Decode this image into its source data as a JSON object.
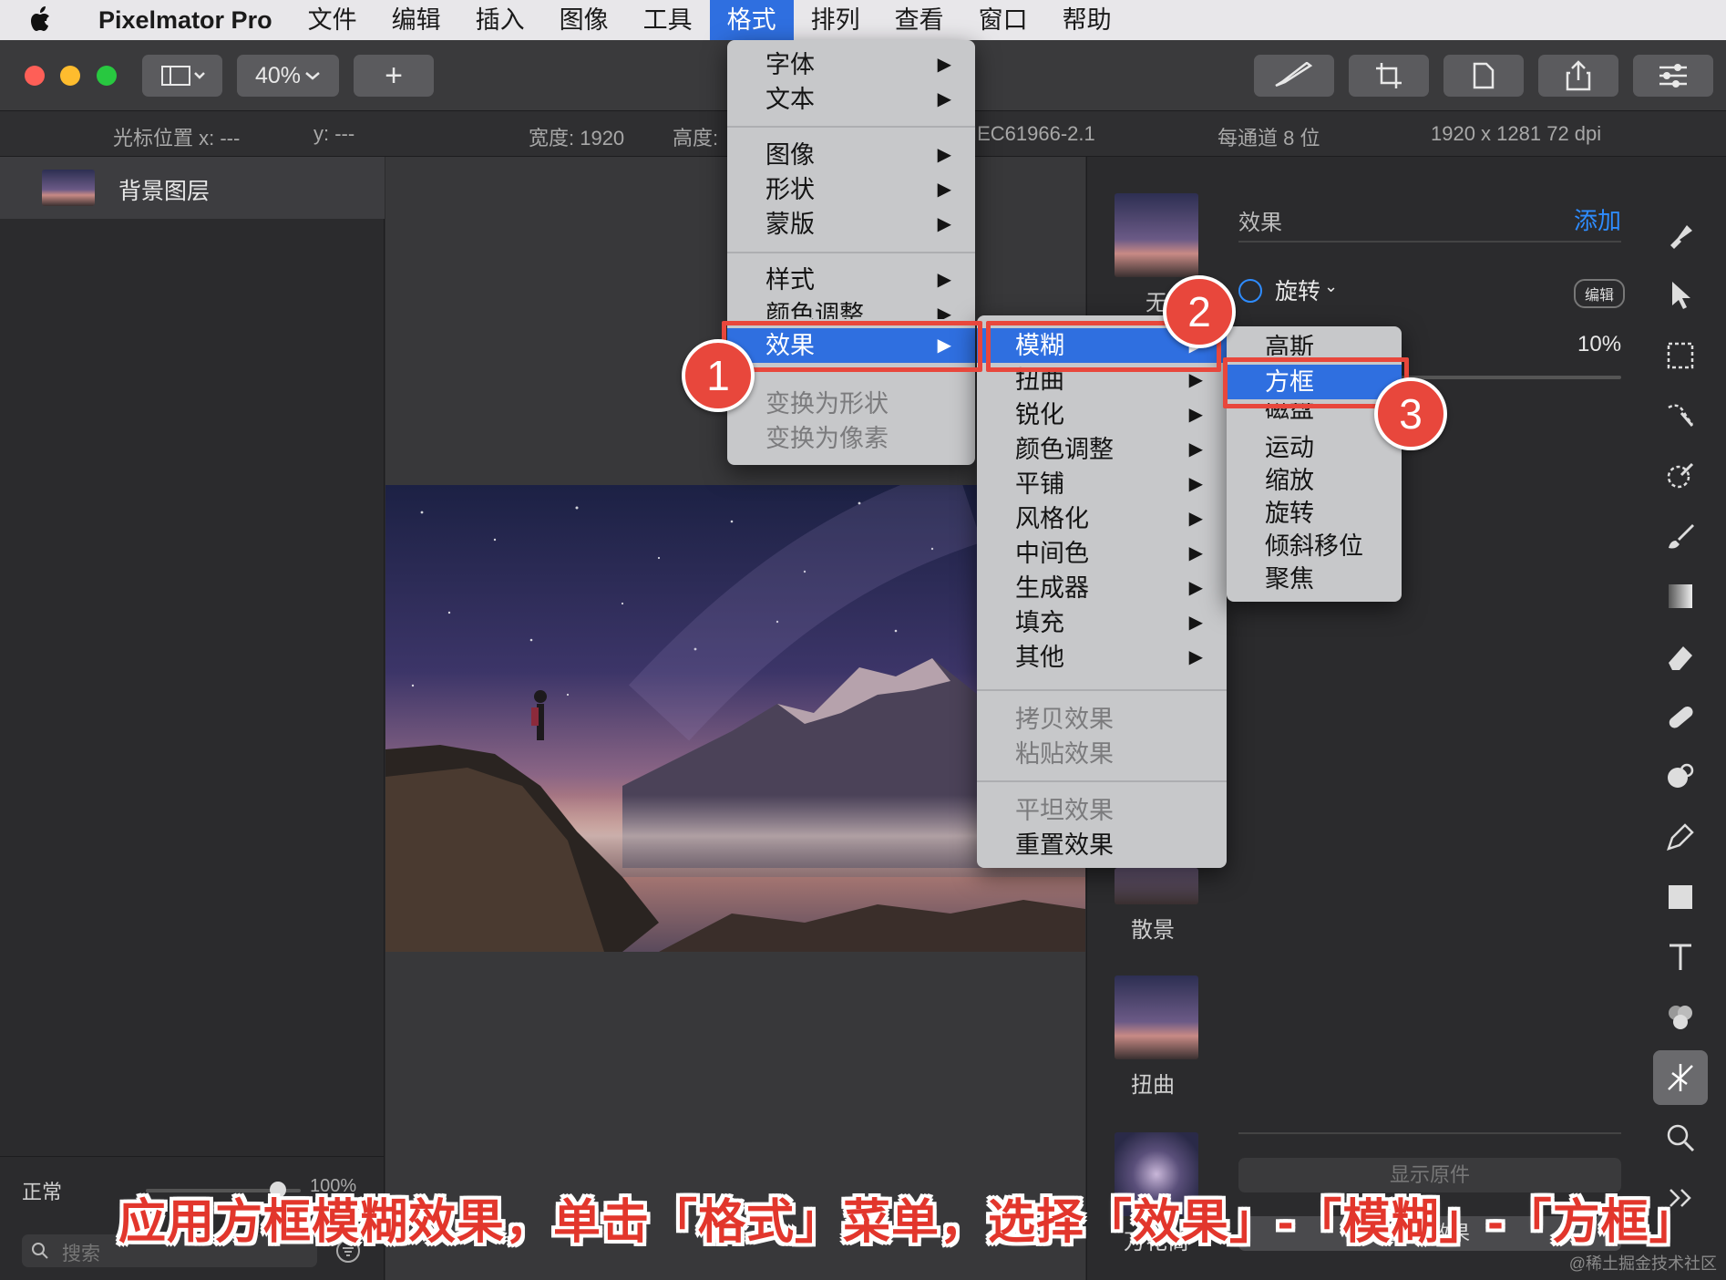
{
  "menubar": {
    "app_name": "Pixelmator Pro",
    "items": [
      "文件",
      "编辑",
      "插入",
      "图像",
      "工具",
      "格式",
      "排列",
      "查看",
      "窗口",
      "帮助"
    ],
    "active": "格式"
  },
  "toolbar": {
    "zoom": "40%",
    "add": "+"
  },
  "infobar": {
    "cursor_x": "光标位置 x:  ---",
    "cursor_y": "y:  ---",
    "width": "宽度:  1920",
    "height": "高度:",
    "profile": "IEC61966-2.1",
    "bits": "每通道 8 位",
    "size": "1920 x 1281 72 dpi"
  },
  "layers": {
    "items": [
      {
        "name": "背景图层"
      }
    ],
    "blend_mode": "正常",
    "opacity": "100%",
    "search_placeholder": "搜索"
  },
  "effects_panel": {
    "header": "效果",
    "add": "添加",
    "effect_name": "旋转",
    "edit": "编辑",
    "value": "10%",
    "presets": [
      "无",
      "散景",
      "扭曲",
      "万花筒"
    ],
    "show_original": "显示原件",
    "reset": "重置效果"
  },
  "format_menu": {
    "group1": [
      "字体",
      "文本"
    ],
    "group2": [
      "图像",
      "形状",
      "蒙版"
    ],
    "group3": [
      "样式",
      "颜色调整",
      "效果"
    ],
    "group4": [
      "变换为形状",
      "变换为像素"
    ]
  },
  "effects_submenu": {
    "items": [
      "模糊",
      "扭曲",
      "锐化",
      "颜色调整",
      "平铺",
      "风格化",
      "中间色",
      "生成器",
      "填充",
      "其他"
    ],
    "group2": [
      "拷贝效果",
      "粘贴效果"
    ],
    "group3": [
      "平坦效果",
      "重置效果"
    ]
  },
  "blur_submenu": {
    "items": [
      "高斯",
      "方框",
      "磁盘",
      "运动",
      "缩放",
      "旋转",
      "倾斜移位",
      "聚焦"
    ]
  },
  "annotations": {
    "badges": [
      "1",
      "2",
      "3"
    ],
    "caption": "应用方框模糊效果，单击「格式」菜单，选择「效果」-「模糊」-「方框」"
  },
  "watermark": "@稀土掘金技术社区",
  "colors": {
    "accent": "#2f6fe0",
    "annotation_red": "#e8473c",
    "link_blue": "#2e8cff"
  }
}
